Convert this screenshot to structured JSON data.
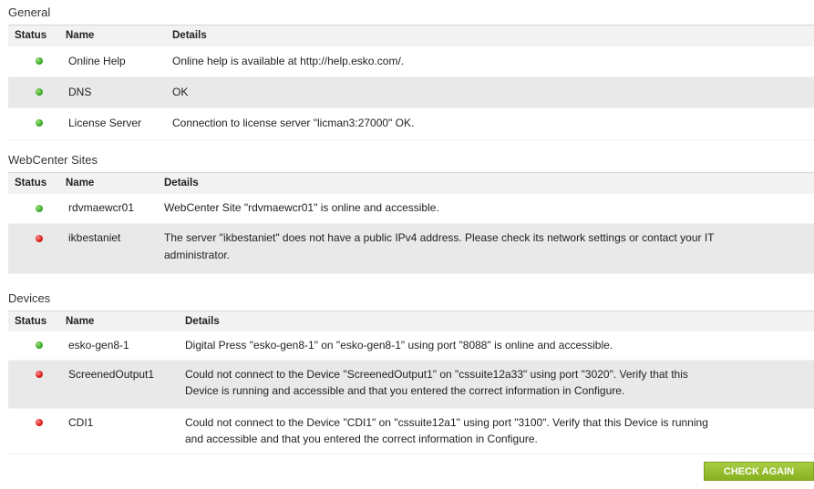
{
  "general": {
    "title": "General",
    "headers": {
      "status": "Status",
      "name": "Name",
      "details": "Details"
    },
    "rows": [
      {
        "status": "ok",
        "name": "Online Help",
        "details": "Online help is available at http://help.esko.com/."
      },
      {
        "status": "ok",
        "name": "DNS",
        "details": "OK"
      },
      {
        "status": "ok",
        "name": "License Server",
        "details": "Connection to license server \"licman3:27000\" OK."
      }
    ]
  },
  "webcenter": {
    "title": "WebCenter Sites",
    "headers": {
      "status": "Status",
      "name": "Name",
      "details": "Details"
    },
    "rows": [
      {
        "status": "ok",
        "name": "rdvmaewcr01",
        "details": "WebCenter Site \"rdvmaewcr01\" is online and accessible."
      },
      {
        "status": "error",
        "name": "ikbestaniet",
        "details_line1": "The server \"ikbestaniet\" does not have a public IPv4 address. Please check its network settings or contact your IT",
        "details_line2": "administrator."
      }
    ]
  },
  "devices": {
    "title": "Devices",
    "headers": {
      "status": "Status",
      "name": "Name",
      "details": "Details"
    },
    "rows": [
      {
        "status": "ok",
        "name": "esko-gen8-1",
        "details": "Digital Press \"esko-gen8-1\" on \"esko-gen8-1\" using port \"8088\" is online and accessible."
      },
      {
        "status": "error",
        "name": "ScreenedOutput1",
        "details_line1": "Could not connect to the Device \"ScreenedOutput1\" on \"cssuite12a33\" using port \"3020\". Verify that this",
        "details_line2": "Device is running and accessible and that you entered the correct information in Configure."
      },
      {
        "status": "error",
        "name": "CDI1",
        "details_line1": "Could not connect to the Device \"CDI1\" on \"cssuite12a1\" using port \"3100\". Verify that this Device is running",
        "details_line2": "and accessible and that you entered the correct information in Configure."
      }
    ]
  },
  "actions": {
    "check_again": "CHECK AGAIN"
  },
  "colors": {
    "ok": "#3aa92a",
    "error": "#d81e1e",
    "button": "#96be2c"
  }
}
